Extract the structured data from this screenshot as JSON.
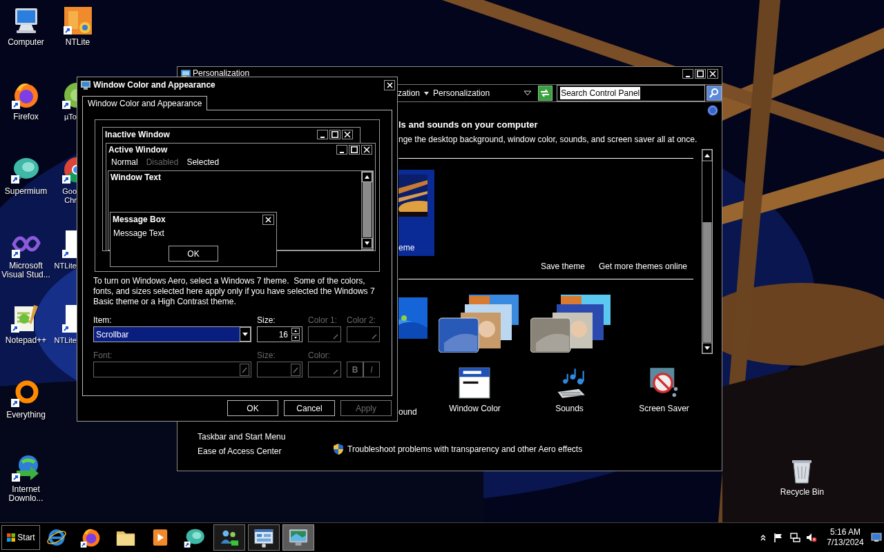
{
  "desktop_icons": {
    "column_1": [
      {
        "label": "Computer",
        "kind": "computer"
      },
      {
        "label": "Firefox",
        "kind": "firefox"
      },
      {
        "label": "Supermium",
        "kind": "supermium"
      },
      {
        "label": "Microsoft\nVisual Stud...",
        "kind": "visual_studio"
      },
      {
        "label": "Notepad++",
        "kind": "notepad"
      },
      {
        "label": "Everything",
        "kind": "everything"
      },
      {
        "label": "Internet\nDownlo...",
        "kind": "downloader"
      }
    ],
    "column_2": [
      {
        "label": "NTLite",
        "kind": "ntlite"
      },
      {
        "label": "µTo",
        "kind": "utorrent"
      },
      {
        "label": "Goo\nChr",
        "kind": "chrome"
      },
      {
        "label": "NTLite",
        "kind": "page"
      },
      {
        "label": "NTLite",
        "kind": "page"
      }
    ],
    "recycle_bin": {
      "label": "Recycle Bin",
      "kind": "recycle"
    }
  },
  "personalization_window": {
    "title": "Personalization",
    "breadcrumb": [
      "zation",
      "Personalization"
    ],
    "search": {
      "value": "Search Control Panel",
      "text_selected": true
    },
    "heading": "ls and sounds on your computer",
    "description": "nge the desktop background, window color, sounds, and screen saver all at once.",
    "my_theme": {
      "label": "eme",
      "selected": true
    },
    "theme_links": [
      "Save theme",
      "Get more themes online"
    ],
    "settings": [
      {
        "label": "ound",
        "kind": "background"
      },
      {
        "label": "Window Color",
        "kind": "window_color"
      },
      {
        "label": "Sounds",
        "kind": "sounds"
      },
      {
        "label": "Screen Saver",
        "kind": "screen_saver"
      }
    ],
    "see_also": [
      "Taskbar and Start Menu",
      "Ease of Access Center"
    ],
    "troubleshoot_link": "Troubleshoot problems with transparency and other Aero effects"
  },
  "dialog": {
    "title": "Window Color and Appearance",
    "tabs": [
      {
        "label": "Window Color and Appearance",
        "selected": true
      }
    ],
    "preview": {
      "inactive_title": "Inactive Window",
      "active_title": "Active Window",
      "menu": [
        {
          "label": "Normal",
          "disabled": false
        },
        {
          "label": "Disabled",
          "disabled": true
        },
        {
          "label": "Selected",
          "disabled": false
        }
      ],
      "window_text": "Window Text",
      "message_box": {
        "title": "Message Box",
        "text": "Message Text",
        "button": "OK"
      }
    },
    "note": "To turn on Windows Aero, select a Windows 7 theme.  Some of the colors, fonts, and sizes selected here apply only if you have selected the Windows 7 Basic theme or a High Contrast theme.",
    "item": {
      "label": "Item:",
      "value": "Scrollbar",
      "highlighted": true,
      "disabled": false
    },
    "size": {
      "label": "Size:",
      "value": "16",
      "disabled": false
    },
    "color_1": {
      "label": "Color 1:",
      "disabled": true
    },
    "color_2": {
      "label": "Color 2:",
      "disabled": true
    },
    "font": {
      "label": "Font:",
      "disabled": true
    },
    "font_size": {
      "label": "Size:",
      "disabled": true
    },
    "font_color": {
      "label": "Color:",
      "disabled": true
    },
    "bold": {
      "label": "B",
      "disabled": true
    },
    "italic": {
      "label": "I",
      "disabled": true
    },
    "buttons": [
      {
        "label": "OK",
        "disabled": false
      },
      {
        "label": "Cancel",
        "disabled": false
      },
      {
        "label": "Apply",
        "disabled": true
      }
    ]
  },
  "taskbar": {
    "start": "Start",
    "buttons": [
      {
        "kind": "browser_e",
        "running": false,
        "active": false
      },
      {
        "kind": "firefox",
        "running": false,
        "active": false
      },
      {
        "kind": "folder",
        "running": false,
        "active": false
      },
      {
        "kind": "media",
        "running": false,
        "active": false
      },
      {
        "kind": "supermium",
        "running": false,
        "active": false
      },
      {
        "kind": "people",
        "running": true,
        "active": false
      },
      {
        "kind": "panel",
        "running": true,
        "active": false
      },
      {
        "kind": "display",
        "running": true,
        "active": true
      }
    ],
    "clock_time": "5:16 AM",
    "clock_date": "7/13/2024"
  }
}
